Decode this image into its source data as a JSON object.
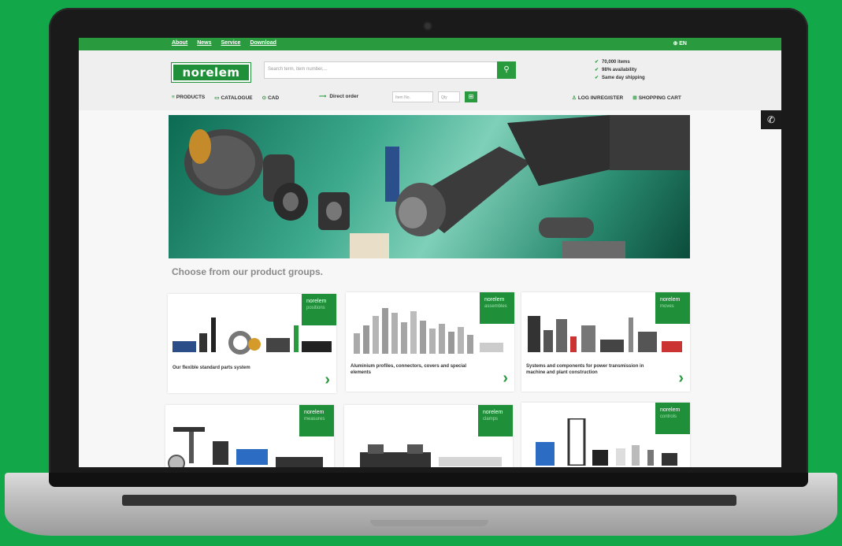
{
  "topbar": {
    "links": [
      "About",
      "News",
      "Service",
      "Download"
    ],
    "language": "EN"
  },
  "brand": {
    "logo_text": "norelem"
  },
  "search": {
    "placeholder": "Search term, item number,..."
  },
  "usps": [
    "70,000 items",
    "98% availability",
    "Same day shipping"
  ],
  "nav": {
    "products": "PRODUCTS",
    "catalogue": "CATALOGUE",
    "cad": "CAD"
  },
  "direct_order": {
    "label": "Direct order",
    "item_placeholder": "Item No.",
    "qty_placeholder": "Qty"
  },
  "account": {
    "login": "LOG IN/REGISTER",
    "cart": "SHOPPING CART"
  },
  "main": {
    "heading": "Choose from our product groups.",
    "cards": [
      {
        "brand": "norelem",
        "sub": "positions",
        "desc": "Our flexible standard parts system"
      },
      {
        "brand": "norelem",
        "sub": "assembles",
        "desc": "Aluminium profiles, connectors, covers and special elements"
      },
      {
        "brand": "norelem",
        "sub": "moves",
        "desc": "Systems and components for power transmission in machine and plant construction"
      },
      {
        "brand": "norelem",
        "sub": "measures",
        "desc": ""
      },
      {
        "brand": "norelem",
        "sub": "clamps",
        "desc": ""
      },
      {
        "brand": "norelem",
        "sub": "controls",
        "desc": ""
      }
    ]
  },
  "colors": {
    "brand_green": "#2a9a3f",
    "background": "#12a84a"
  }
}
